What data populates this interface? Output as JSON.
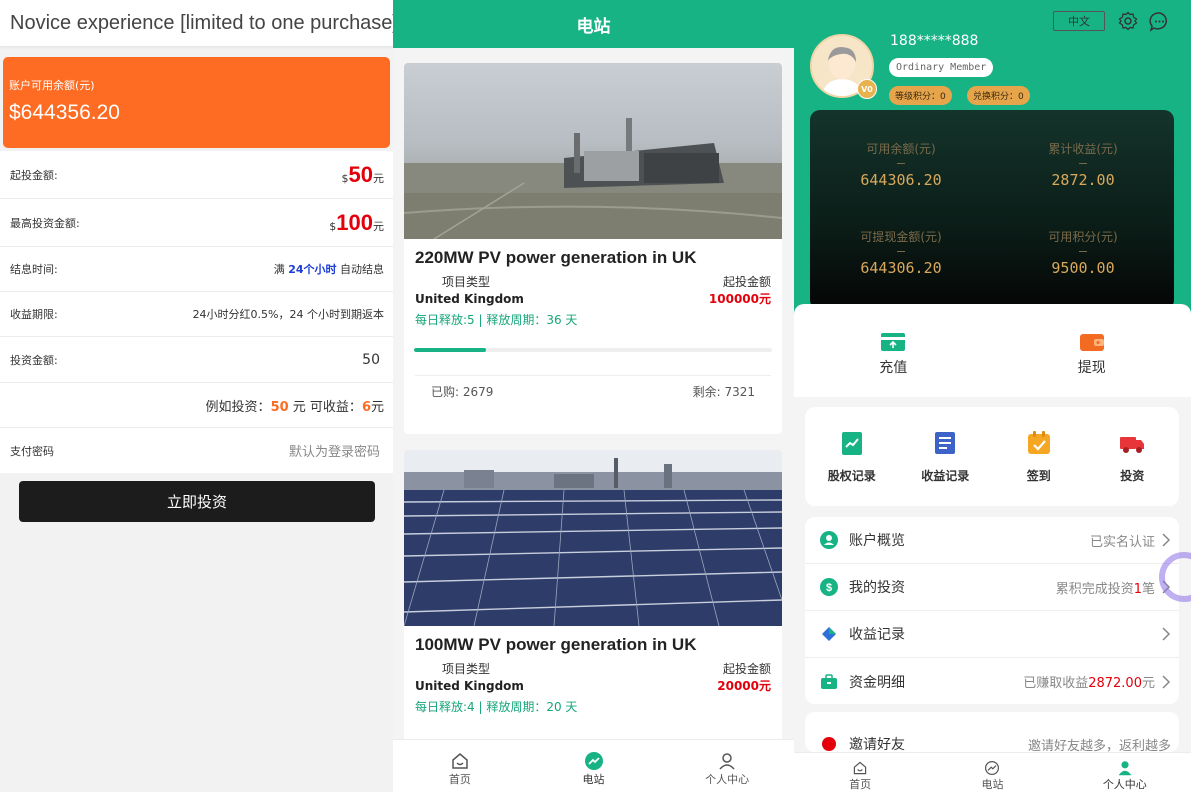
{
  "panel1": {
    "title": "Novice experience [limited to one purchase]",
    "balance_label": "账户可用余额(元)",
    "balance_value": "$644356.20",
    "min_label": "起投金额:",
    "min_currency": "$",
    "min_value": "50",
    "min_unit": "元",
    "max_label": "最高投资金额:",
    "max_currency": "$",
    "max_value": "100",
    "max_unit": "元",
    "settle_label": "结息时间:",
    "settle_prefix": "满",
    "settle_hours": "24个小时",
    "settle_suffix": "自动结息",
    "period_label": "收益期限:",
    "period_value": "24小时分红0.5%，24 个小时到期返本",
    "amount_label": "投资金额:",
    "amount_value": "50",
    "example_prefix": "例如投资：",
    "example_invest": "50",
    "example_mid": "元 可收益：",
    "example_profit": "6",
    "example_unit": "元",
    "pwd_label": "支付密码",
    "pwd_placeholder": "默认为登录密码",
    "invest_button": "立即投资"
  },
  "panel2": {
    "header": "电站",
    "cards": [
      {
        "title": "220MW PV power generation in UK",
        "type_label": "项目类型",
        "type_value": "United Kingdom",
        "min_label": "起投金额",
        "min_value": "100000元",
        "daily": "每日释放:5 | 释放周期：36 天",
        "progress": 0.2,
        "bought": "已购: 2679",
        "remain": "剩余: 7321"
      },
      {
        "title": "100MW PV power generation in UK",
        "type_label": "项目类型",
        "type_value": "United Kingdom",
        "min_label": "起投金额",
        "min_value": "20000元",
        "daily": "每日释放:4 | 释放周期：20 天"
      }
    ],
    "tabs": [
      "首页",
      "电站",
      "个人中心"
    ]
  },
  "panel3": {
    "lang": "中文",
    "phone": "188*****888",
    "member": "Ordinary Member",
    "vip": "V0",
    "level_points": "等级积分：0",
    "exchange_points": "兑换积分：0",
    "stats": [
      {
        "label": "可用余额(元)",
        "value": "644306.20"
      },
      {
        "label": "累计收益(元)",
        "value": "2872.00"
      },
      {
        "label": "可提现金额(元)",
        "value": "644306.20"
      },
      {
        "label": "可用积分(元)",
        "value": "9500.00"
      }
    ],
    "recharge": "充值",
    "withdraw": "提现",
    "grid": [
      "股权记录",
      "收益记录",
      "签到",
      "投资"
    ],
    "list": [
      {
        "title": "账户概览",
        "right": "已实名认证"
      },
      {
        "title": "我的投资",
        "right_prefix": "累积完成投资",
        "right_red": "1",
        "right_suffix": "笔"
      },
      {
        "title": "收益记录",
        "right": ""
      },
      {
        "title": "资金明细",
        "right_prefix": "已赚取收益",
        "right_red": "2872.00",
        "right_suffix": "元"
      }
    ],
    "invite_title": "邀请好友",
    "invite_right": "邀请好友越多，返利越多",
    "tabs": [
      "首页",
      "电站",
      "个人中心"
    ]
  },
  "colors": {
    "primary_green": "#17b384",
    "orange": "#fe6b22",
    "red": "#e3000b",
    "gold": "#d9a85a"
  }
}
